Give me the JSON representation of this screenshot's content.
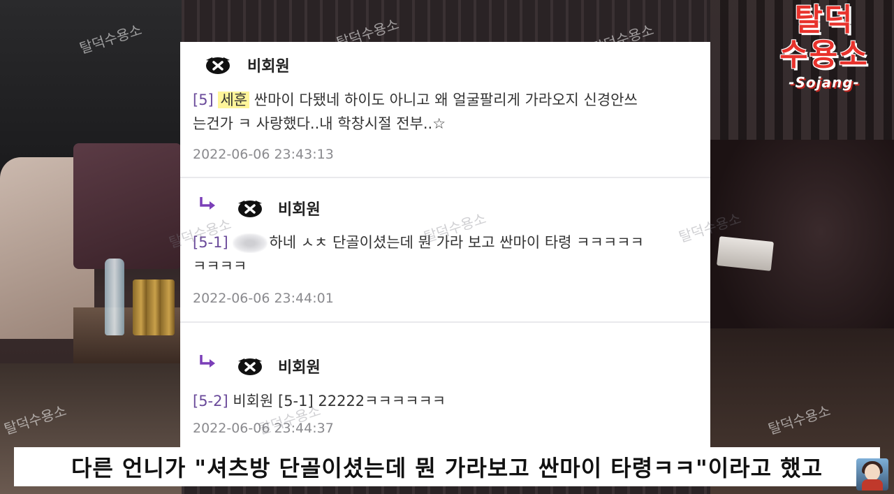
{
  "logo": {
    "line1": "탈덕",
    "line2": "수용소",
    "subtitle": "-Sojang-"
  },
  "watermark": "탈덕수용소",
  "comments": [
    {
      "author": "비회원",
      "avatar_icon": "masked-face-icon",
      "ref": "[5]",
      "highlight": "세훈",
      "line1": " 싼마이 다됐네 하이도 아니고 왜 얼굴팔리게 가라오지 신경안쓰",
      "line2": "는건가 ㅋ 사랑했다..내 학창시절 전부..☆",
      "date": "2022-06-06 23:43:13"
    },
    {
      "author": "비회원",
      "avatar_icon": "masked-face-icon",
      "reply_icon": "reply-arrow-icon",
      "ref": "[5-1]",
      "line1": "하네 ㅅㅊ 단골이셨는데 뭔 가라 보고 싼마이 타령 ㅋㅋㅋㅋㅋ",
      "line2": "ㅋㅋㅋㅋ",
      "date": "2022-06-06 23:44:01"
    },
    {
      "author": "비회원",
      "avatar_icon": "masked-face-icon",
      "reply_icon": "reply-arrow-icon",
      "ref": "[5-2]",
      "line1": " 비회원 [5-1]  22222ㅋㅋㅋㅋㅋㅋ",
      "date": "2022-06-06 23:44:37"
    }
  ],
  "subtitle": "다른 언니가 \"셔츠방 단골이셨는데 뭔 가라보고 싼마이 타령ㅋㅋ\"이라고 했고",
  "colors": {
    "logo_red": "#e8322c",
    "ref_purple": "#6a4a9a",
    "highlight_yellow": "#fff59a",
    "reply_purple": "#7b3fb8"
  }
}
